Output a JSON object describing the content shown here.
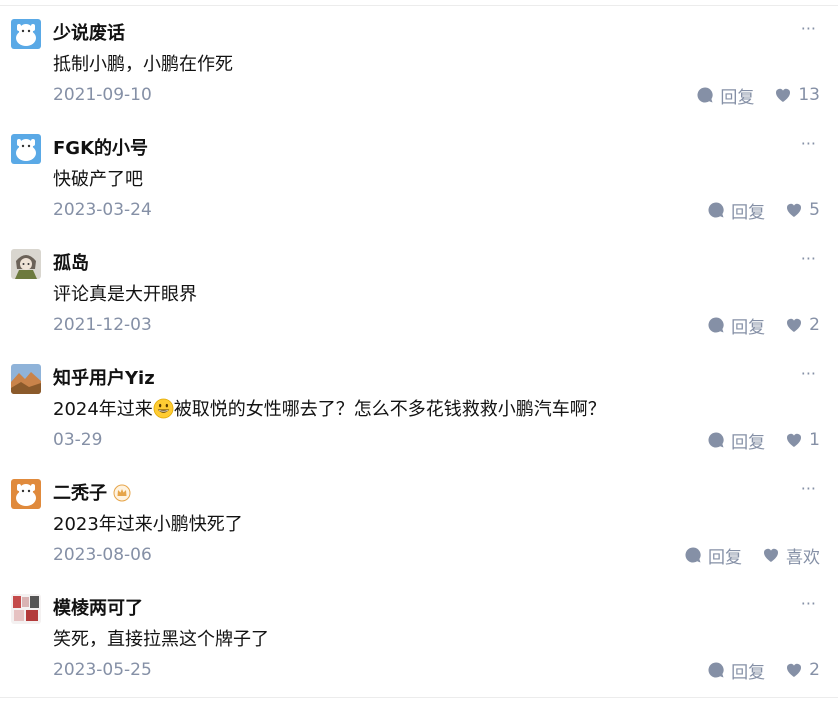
{
  "comments": [
    {
      "author": "少说废话",
      "content": "抵制小鹏，小鹏在作死",
      "date": "2021-09-10",
      "reply_label": "回复",
      "likes": "13",
      "more": "···",
      "avatar": "white-dog-blue-icon"
    },
    {
      "author": "FGK的小号",
      "content": "快破产了吧",
      "date": "2023-03-24",
      "reply_label": "回复",
      "likes": "5",
      "more": "···",
      "avatar": "white-dog-blue-icon"
    },
    {
      "author": "孤岛",
      "content": "评论真是大开眼界",
      "date": "2021-12-03",
      "reply_label": "回复",
      "likes": "2",
      "more": "···",
      "avatar": "anime-character-icon"
    },
    {
      "author": "知乎用户Yiz",
      "content_before": "2024年过来",
      "content_after": "被取悦的女性哪去了？怎么不多花钱救救小鹏汽车啊？",
      "date": "03-29",
      "reply_label": "回复",
      "likes": "1",
      "more": "···",
      "avatar": "landscape-icon"
    },
    {
      "author": "二秃子",
      "content": "2023年过来小鹏快死了",
      "date": "2023-08-06",
      "reply_label": "回复",
      "likes": "喜欢",
      "more": "···",
      "avatar": "orange-dog-icon"
    },
    {
      "author": "模棱两可了",
      "content": "笑死，直接拉黑这个牌子了",
      "date": "2023-05-25",
      "reply_label": "回复",
      "likes": "2",
      "more": "···",
      "avatar": "collage-icon"
    }
  ],
  "colors": {
    "muted": "#8590a6",
    "text": "#121212",
    "divider": "#ececec"
  }
}
